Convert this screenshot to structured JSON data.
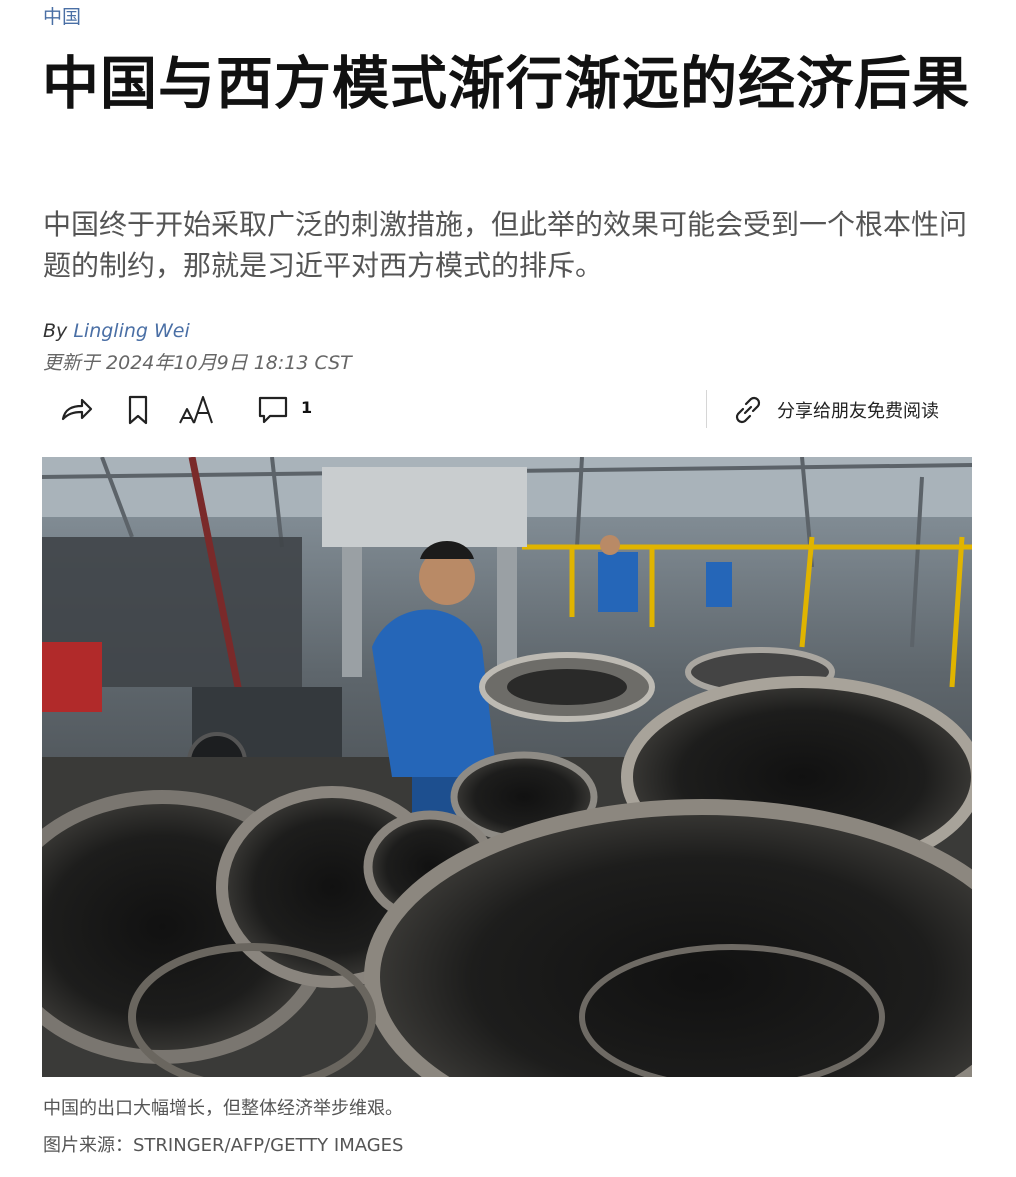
{
  "section": "中国",
  "headline": "中国与西方模式渐行渐远的经济后果",
  "dek": "中国终于开始采取广泛的刺激措施，但此举的效果可能会受到一个根本性问题的制约，那就是习近平对西方模式的排斥。",
  "byline": {
    "prefix": "By",
    "author": "Lingling Wei"
  },
  "timestamp": "更新于 2024年10月9日 18:13 CST",
  "toolbar": {
    "share_icon": "share-arrow-icon",
    "bookmark_icon": "bookmark-icon",
    "text_size_icon": "text-size-icon",
    "text_size_label": "AA",
    "comments_icon": "comment-bubble-icon",
    "comment_count": "1",
    "gift_icon": "link-icon",
    "gift_label": "分享给朋友免费阅读"
  },
  "image": {
    "caption": "中国的出口大幅增长，但整体经济举步维艰。",
    "credit": "图片来源：STRINGER/AFP/GETTY IMAGES"
  },
  "colors": {
    "link": "#4a6fa5",
    "workwear_blue": "#2566b8",
    "safety_yellow": "#e0b400"
  }
}
